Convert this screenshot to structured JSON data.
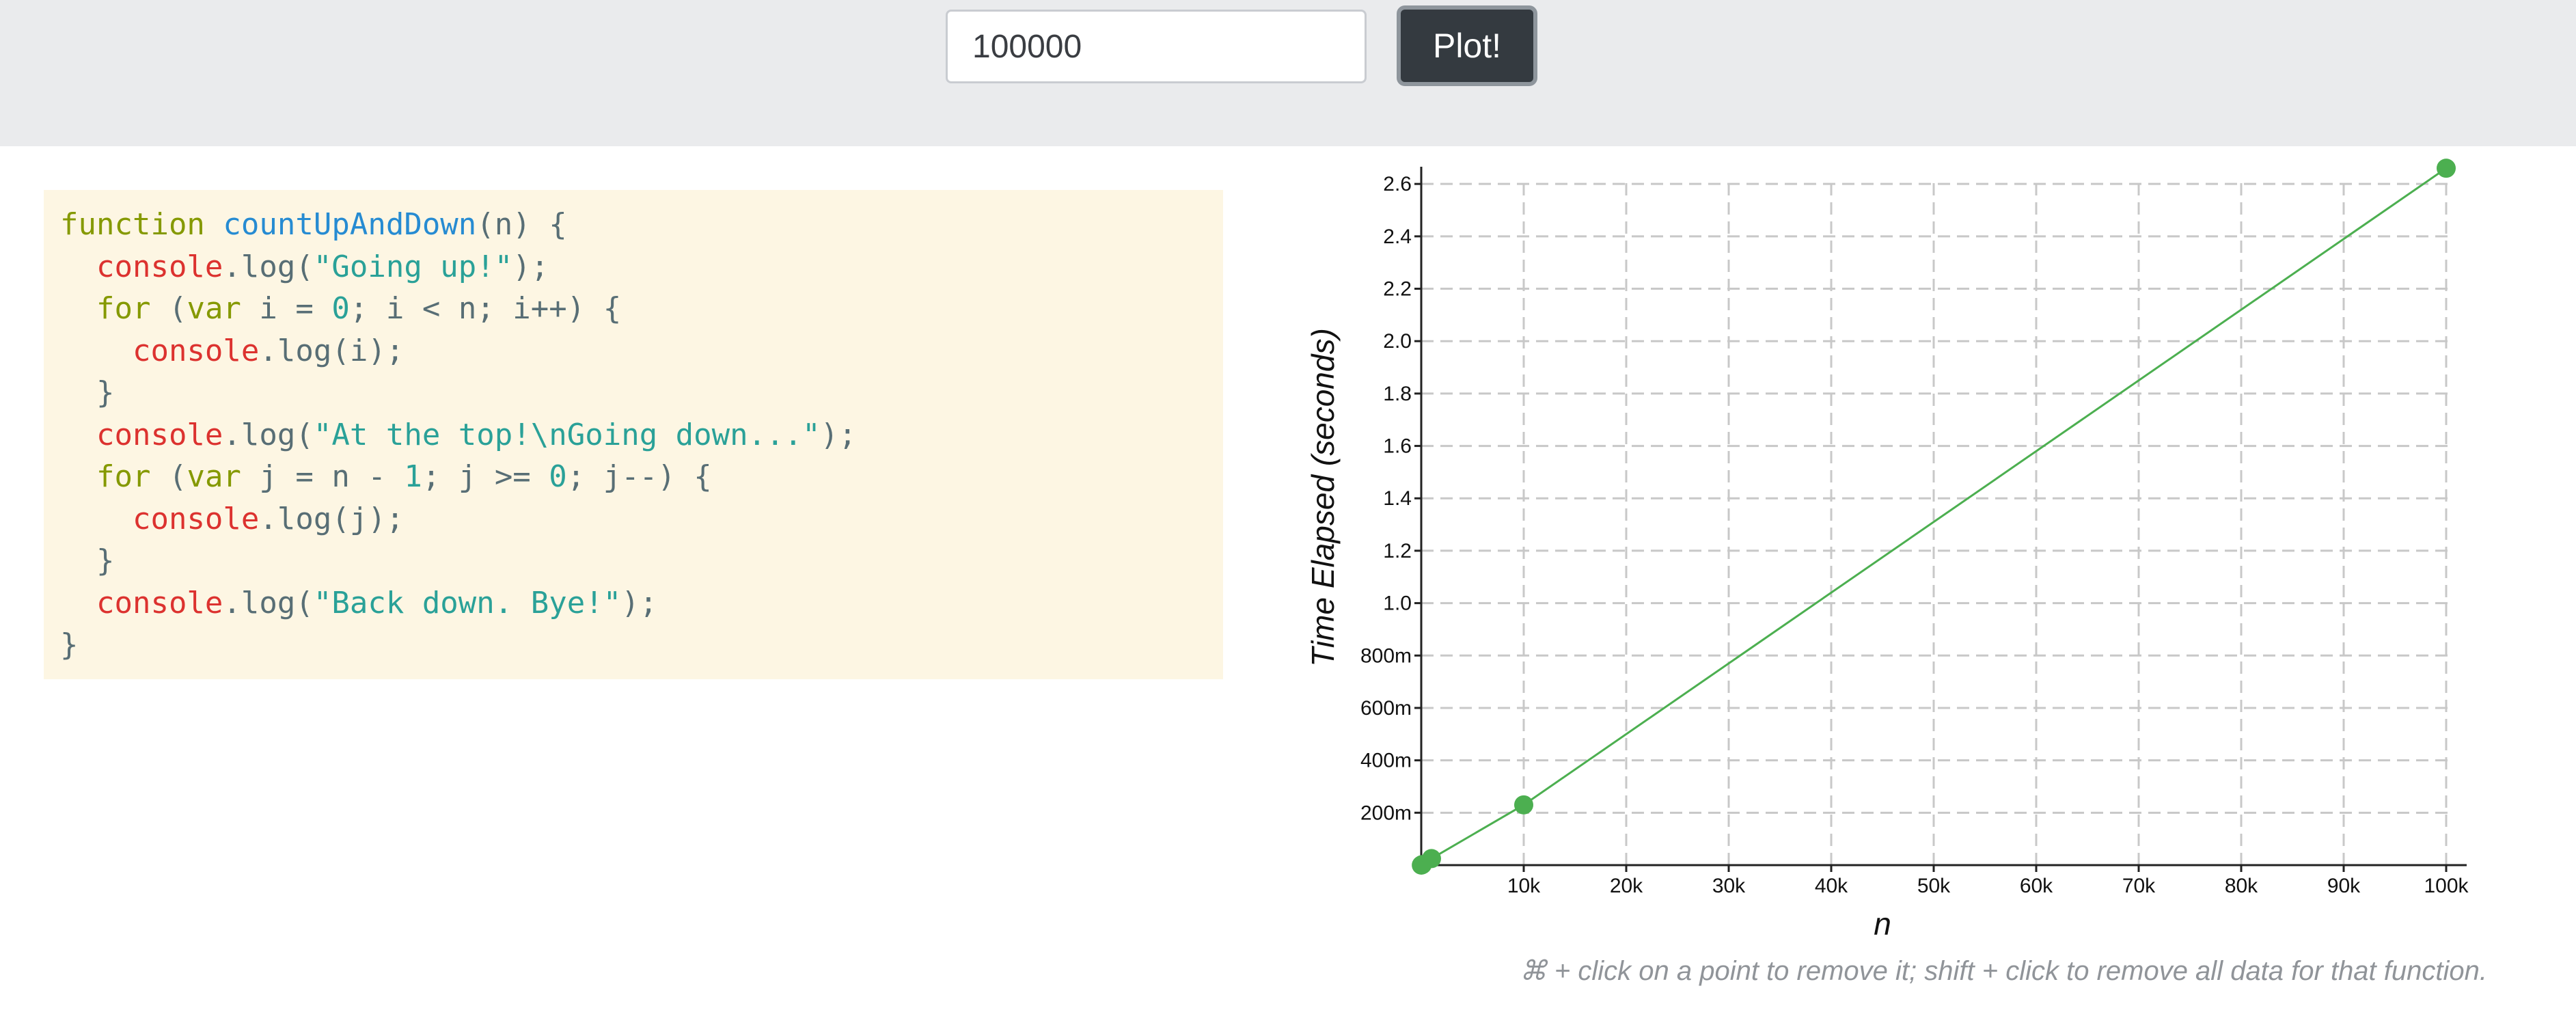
{
  "toolbar": {
    "input_value": "100000",
    "plot_label": "Plot!"
  },
  "code": {
    "lines": [
      [
        {
          "t": "function ",
          "c": "kw"
        },
        {
          "t": "countUpAndDown",
          "c": "fn"
        },
        {
          "t": "(n) {",
          "c": ""
        }
      ],
      [
        {
          "t": "  ",
          "c": ""
        },
        {
          "t": "console",
          "c": "obj"
        },
        {
          "t": ".log(",
          "c": ""
        },
        {
          "t": "\"Going up!\"",
          "c": "str"
        },
        {
          "t": ");",
          "c": ""
        }
      ],
      [
        {
          "t": "  ",
          "c": ""
        },
        {
          "t": "for",
          "c": "kw"
        },
        {
          "t": " (",
          "c": ""
        },
        {
          "t": "var",
          "c": "kw"
        },
        {
          "t": " i = ",
          "c": ""
        },
        {
          "t": "0",
          "c": "num"
        },
        {
          "t": "; i < n; i++) {",
          "c": ""
        }
      ],
      [
        {
          "t": "    ",
          "c": ""
        },
        {
          "t": "console",
          "c": "obj"
        },
        {
          "t": ".log(i);",
          "c": ""
        }
      ],
      [
        {
          "t": "  }",
          "c": ""
        }
      ],
      [
        {
          "t": "  ",
          "c": ""
        },
        {
          "t": "console",
          "c": "obj"
        },
        {
          "t": ".log(",
          "c": ""
        },
        {
          "t": "\"At the top!\\nGoing down...\"",
          "c": "str"
        },
        {
          "t": ");",
          "c": ""
        }
      ],
      [
        {
          "t": "  ",
          "c": ""
        },
        {
          "t": "for",
          "c": "kw"
        },
        {
          "t": " (",
          "c": ""
        },
        {
          "t": "var",
          "c": "kw"
        },
        {
          "t": " j = n - ",
          "c": ""
        },
        {
          "t": "1",
          "c": "num"
        },
        {
          "t": "; j >= ",
          "c": ""
        },
        {
          "t": "0",
          "c": "num"
        },
        {
          "t": "; j--) {",
          "c": ""
        }
      ],
      [
        {
          "t": "    ",
          "c": ""
        },
        {
          "t": "console",
          "c": "obj"
        },
        {
          "t": ".log(j);",
          "c": ""
        }
      ],
      [
        {
          "t": "  }",
          "c": ""
        }
      ],
      [
        {
          "t": "  ",
          "c": ""
        },
        {
          "t": "console",
          "c": "obj"
        },
        {
          "t": ".log(",
          "c": ""
        },
        {
          "t": "\"Back down. Bye!\"",
          "c": "str"
        },
        {
          "t": ");",
          "c": ""
        }
      ],
      [
        {
          "t": "}",
          "c": ""
        }
      ]
    ]
  },
  "chart_data": {
    "type": "line",
    "xlabel": "n",
    "ylabel": "Time Elapsed (seconds)",
    "xlim": [
      0,
      100000
    ],
    "ylim": [
      0,
      2.65
    ],
    "x_ticks": [
      10000,
      20000,
      30000,
      40000,
      50000,
      60000,
      70000,
      80000,
      90000,
      100000
    ],
    "x_tick_labels": [
      "10k",
      "20k",
      "30k",
      "40k",
      "50k",
      "60k",
      "70k",
      "80k",
      "90k",
      "100k"
    ],
    "y_ticks": [
      0.2,
      0.4,
      0.6,
      0.8,
      1.0,
      1.2,
      1.4,
      1.6,
      1.8,
      2.0,
      2.2,
      2.4,
      2.6
    ],
    "y_tick_labels": [
      "200m",
      "400m",
      "600m",
      "800m",
      "1.0",
      "1.2",
      "1.4",
      "1.6",
      "1.8",
      "2.0",
      "2.2",
      "2.4",
      "2.6"
    ],
    "grid": true,
    "series": [
      {
        "color": "#4caf50",
        "points": [
          {
            "x": 10,
            "y": 0.0
          },
          {
            "x": 100,
            "y": 0.002
          },
          {
            "x": 1000,
            "y": 0.025
          },
          {
            "x": 10000,
            "y": 0.23
          },
          {
            "x": 100000,
            "y": 2.66
          }
        ]
      }
    ]
  },
  "hint": "⌘ + click on a point to remove it; shift + click to remove all data for that function."
}
